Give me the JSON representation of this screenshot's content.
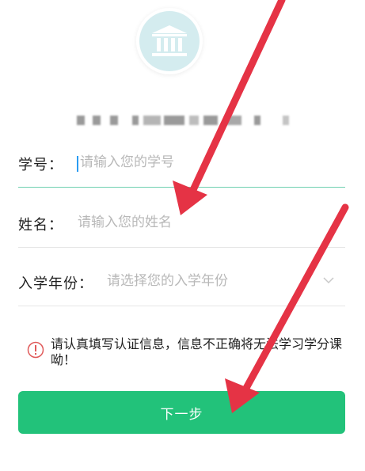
{
  "institution": {
    "icon": "bank-building-icon"
  },
  "form": {
    "student_id": {
      "label": "学号：",
      "placeholder": "请输入您的学号"
    },
    "name": {
      "label": "姓名：",
      "placeholder": "请输入您的姓名"
    },
    "enrollment_year": {
      "label": "入学年份：",
      "placeholder": "请选择您的入学年份"
    }
  },
  "notice": {
    "text": "请认真填写认证信息，信息不正确将无法学习学分课呦！"
  },
  "next_button": {
    "label": "下一步"
  },
  "colors": {
    "accent": "#22c27a",
    "logo_bg": "#d4ecef",
    "annotation_arrow": "#e53345",
    "warning_icon": "#e05a5a"
  }
}
